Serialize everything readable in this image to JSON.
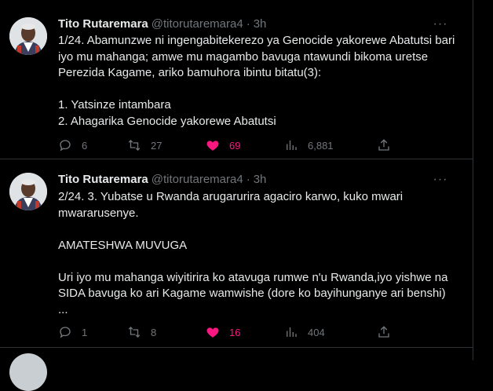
{
  "tweets": [
    {
      "author_name": "Tito Rutaremara",
      "handle": "@titorutaremara4",
      "separator": "·",
      "time": "3h",
      "more_label": "···",
      "text": "1/24. Abamunzwe ni ingengabitekerezo ya Genocide yakorewe Abatutsi bari iyo mu mahanga; amwe mu magambo bavuga ntawundi bikoma uretse Perezida Kagame, ariko bamuhora ibintu bitatu(3):\n\n1. Yatsinze intambara\n2. Ahagarika Genocide yakorewe Abatutsi",
      "replies": "6",
      "retweets": "27",
      "likes": "69",
      "views": "6,881"
    },
    {
      "author_name": "Tito Rutaremara",
      "handle": "@titorutaremara4",
      "separator": "·",
      "time": "3h",
      "more_label": "···",
      "text": "2/24. 3. Yubatse u Rwanda arugarurira agaciro karwo, kuko mwari mwararusenye.\n\nAMATESHWA MUVUGA\n\nUri iyo mu mahanga wiyitirira ko atavuga rumwe n'u Rwanda,iyo yishwe na SIDA bavuga ko ari Kagame wamwishe (dore ko bayihunganye ari benshi) ...",
      "replies": "1",
      "retweets": "8",
      "likes": "16",
      "views": "404"
    }
  ],
  "colors": {
    "background": "#000000",
    "text": "#e7e9ea",
    "muted": "#71767b",
    "like_active": "#f91880",
    "divider": "#2f3336"
  },
  "icons": {
    "reply": "reply-icon",
    "retweet": "retweet-icon",
    "like": "heart-filled-icon",
    "views": "views-chart-icon",
    "share": "share-icon",
    "more": "more-icon"
  }
}
